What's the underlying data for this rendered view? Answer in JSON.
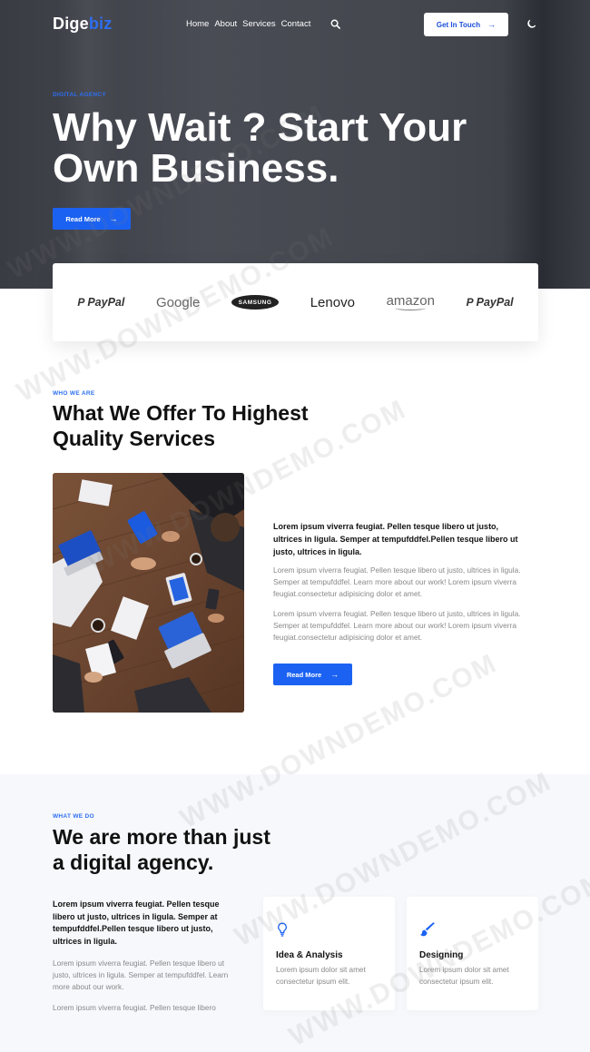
{
  "header": {
    "logo_main": "Dige",
    "logo_accent": "biz",
    "nav": [
      "Home",
      "About",
      "Services",
      "Contact"
    ],
    "cta_label": "Get In Touch"
  },
  "hero": {
    "eyebrow": "DIGITAL AGENCY",
    "title_line1": "Why Wait ? Start Your",
    "title_line2": "Own Business.",
    "button_label": "Read More"
  },
  "brands": [
    "PayPal",
    "Google",
    "SAMSUNG",
    "Lenovo",
    "amazon",
    "PayPal"
  ],
  "offer": {
    "eyebrow": "WHO WE ARE",
    "title_line1": "What We Offer To Highest",
    "title_line2": "Quality Services",
    "lead": "Lorem ipsum viverra feugiat. Pellen tesque libero ut justo, ultrices in ligula. Semper at tempufddfel.Pellen tesque libero ut justo, ultrices in ligula.",
    "para1": "Lorem ipsum viverra feugiat. Pellen tesque libero ut justo, ultrices in ligula. Semper at tempufddfel. Learn more about our work! Lorem ipsum viverra feugiat.consectetur adipisicing dolor et amet.",
    "para2": "Lorem ipsum viverra feugiat. Pellen tesque libero ut justo, ultrices in ligula. Semper at tempufddfel. Learn more about our work! Lorem ipsum viverra feugiat.consectetur adipisicing dolor et amet.",
    "button_label": "Read More"
  },
  "whatwedo": {
    "eyebrow": "WHAT WE DO",
    "title_line1": "We are more than just",
    "title_line2": "a digital agency.",
    "lead": "Lorem ipsum viverra feugiat. Pellen tesque libero ut justo, ultrices in ligula. Semper at tempufddfel.Pellen tesque libero ut justo, ultrices in ligula.",
    "para1": "Lorem ipsum viverra feugiat. Pellen tesque libero ut justo, ultrices in ligula. Semper at tempufddfel. Learn more about our work.",
    "para2": "Lorem ipsum viverra feugiat. Pellen tesque libero",
    "cards": [
      {
        "title": "Idea & Analysis",
        "desc": "Lorem ipsum dolor sit amet consectetur ipsum elit.",
        "icon": "lightbulb-icon"
      },
      {
        "title": "Designing",
        "desc": "Lorem ipsum dolor sit amet consectetur ipsum elit.",
        "icon": "brush-icon"
      }
    ]
  },
  "watermark": "WWW.DOWNDEMO.COM",
  "colors": {
    "accent": "#1b62f2",
    "hero_bg": "#45474f",
    "section_bg": "#f7f8fc"
  }
}
